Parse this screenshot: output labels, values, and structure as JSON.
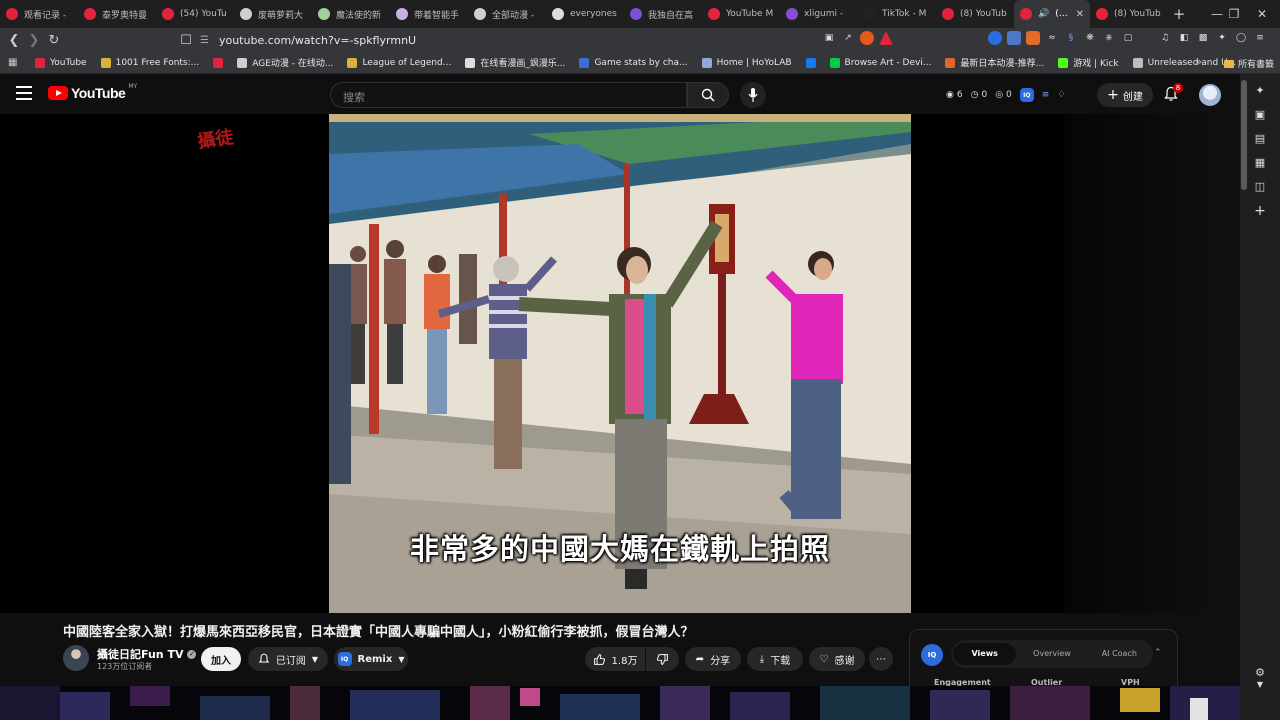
{
  "browser": {
    "tabs": [
      {
        "label": "观看记录 -",
        "color": "#e2233b"
      },
      {
        "label": "泰罗奥特曼",
        "color": "#e2233b"
      },
      {
        "label": "(54) YouTu",
        "color": "#e2233b"
      },
      {
        "label": "废萌萝莉大",
        "color": "#cfcfcf"
      },
      {
        "label": "魔法使的新",
        "color": "#9fd19a"
      },
      {
        "label": "带着智能手",
        "color": "#c8b3e0"
      },
      {
        "label": "全部动漫 -",
        "color": "#d0d0d0"
      },
      {
        "label": "everyones",
        "color": "#dddddd"
      },
      {
        "label": "我独自在高",
        "color": "#7b4fd6"
      },
      {
        "label": "YouTube M",
        "color": "#e2233b"
      },
      {
        "label": "xligumi -",
        "color": "#8a4cd8"
      },
      {
        "label": "TikTok - M",
        "color": "#222222"
      },
      {
        "label": "(8) YouTub",
        "color": "#e2233b"
      },
      {
        "label": "(8) Y",
        "color": "#e2233b",
        "active": true
      },
      {
        "label": "(8) YouTub",
        "color": "#e2233b"
      }
    ],
    "url": "youtube.com/watch?v=-spkflyrmnU",
    "bookmarks": [
      {
        "label": "YouTube",
        "color": "#e2233b"
      },
      {
        "label": "1001 Free Fonts:...",
        "color": "#d9b23c"
      },
      {
        "label": "",
        "color": "#e2233b"
      },
      {
        "label": "AGE动漫 - 在线动...",
        "color": "#cfcfcf"
      },
      {
        "label": "League of Legend...",
        "color": "#d9b23c"
      },
      {
        "label": "在线看漫画_飒漫乐...",
        "color": "#dddddd"
      },
      {
        "label": "Game stats by cha...",
        "color": "#3b6fd4"
      },
      {
        "label": "Home | HoYoLAB",
        "color": "#8fa9d9"
      },
      {
        "label": "",
        "color": "#1877f2"
      },
      {
        "label": "Browse Art - Devi...",
        "color": "#05cc47"
      },
      {
        "label": "最新日本动漫-推荐...",
        "color": "#e0662a"
      },
      {
        "label": "游戏 | Kick",
        "color": "#53fc18"
      },
      {
        "label": "Unreleased and U...",
        "color": "#bdbdbd"
      }
    ],
    "all_bookmarks": "所有書籤"
  },
  "youtube": {
    "logo_text": "YouTube",
    "region": "MY",
    "search_placeholder": "搜索",
    "stats": [
      {
        "icon": "eye-icon",
        "value": "6"
      },
      {
        "icon": "clock-icon",
        "value": "0"
      },
      {
        "icon": "circle-icon",
        "value": "0"
      }
    ],
    "create_label": "创建",
    "notification_count": "8"
  },
  "video": {
    "caption": "非常多的中國大媽在鐵軌上拍照",
    "watermark": "攝徒"
  },
  "meta": {
    "title": "中國陸客全家入獄！打爆馬來西亞移民官，日本證實「中國人專騙中國人」，小粉紅偷行李被抓，假冒台灣人？",
    "channel_name": "攝徒日記Fun TV",
    "subscribers": "123万位订阅者",
    "join_label": "加入",
    "subscribed_label": "已订阅",
    "remix_label": "Remix",
    "like_count": "1.8万",
    "share_label": "分享",
    "download_label": "下载",
    "thanks_label": "感谢"
  },
  "iq_panel": {
    "logo": "IQ",
    "tabs": [
      "Views",
      "Overview",
      "AI Coach"
    ],
    "active_tab": "Views",
    "metrics": [
      "Engagement",
      "Outlier",
      "VPH"
    ]
  }
}
